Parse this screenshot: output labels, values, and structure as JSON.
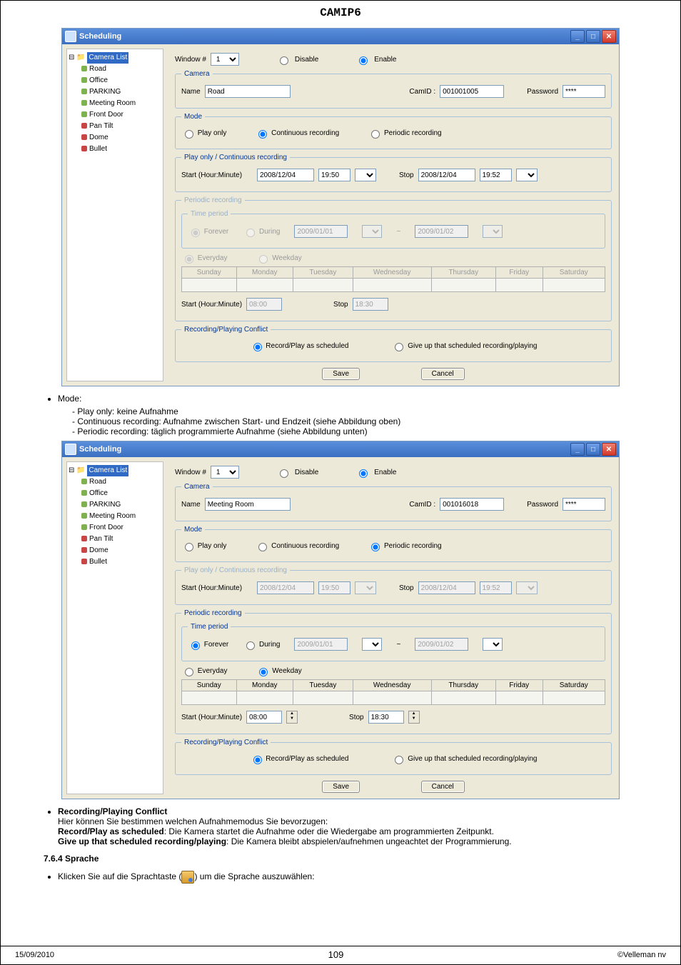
{
  "doc_title": "CAMIP6",
  "win1": {
    "title": "Scheduling",
    "tree": {
      "root": "Camera List",
      "items": [
        {
          "label": "Road",
          "color": "cg"
        },
        {
          "label": "Office",
          "color": "cg"
        },
        {
          "label": "PARKING",
          "color": "cg"
        },
        {
          "label": "Meeting Room",
          "color": "cg"
        },
        {
          "label": "Front Door",
          "color": "cg"
        },
        {
          "label": "Pan Tilt",
          "color": "cr"
        },
        {
          "label": "Dome",
          "color": "cr"
        },
        {
          "label": "Bullet",
          "color": "cr"
        }
      ]
    },
    "window_label": "Window #",
    "window_value": "1",
    "disable": "Disable",
    "enable": "Enable",
    "camera_legend": "Camera",
    "name_label": "Name",
    "name_value": "Road",
    "camid_label": "CamID :",
    "camid_value": "001001005",
    "password_label": "Password",
    "password_value": "****",
    "mode_legend": "Mode",
    "mode_play": "Play only",
    "mode_cont": "Continuous recording",
    "mode_per": "Periodic recording",
    "play_legend": "Play only / Continuous recording",
    "start_label": "Start (Hour:Minute)",
    "start_date": "2008/12/04",
    "start_time": "19:50",
    "stop_label": "Stop",
    "stop_date": "2008/12/04",
    "stop_time": "19:52",
    "periodic_legend": "Periodic recording",
    "timeperiod_legend": "Time period",
    "forever": "Forever",
    "during": "During",
    "during_from": "2009/01/01",
    "during_to": "2009/01/02",
    "everyday": "Everyday",
    "weekday": "Weekday",
    "days": [
      "Sunday",
      "Monday",
      "Tuesday",
      "Wednesday",
      "Thursday",
      "Friday",
      "Saturday"
    ],
    "start_hm_label": "Start (Hour:Minute)",
    "start_hm": "08:00",
    "stop_hm_label": "Stop",
    "stop_hm": "18:30",
    "conflict_legend": "Recording/Playing Conflict",
    "conflict_a": "Record/Play as scheduled",
    "conflict_b": "Give up that scheduled recording/playing",
    "save": "Save",
    "cancel": "Cancel"
  },
  "win2": {
    "name_value": "Meeting Room",
    "camid_value": "001016018"
  },
  "text": {
    "mode_h": "Mode:",
    "mode_li1": "Play only: keine Aufnahme",
    "mode_li2": "Continuous recording: Aufnahme zwischen Start- und Endzeit (siehe Abbildung oben)",
    "mode_li3": "Periodic recording: täglich programmierte Aufnahme (siehe Abbildung unten)",
    "conflict_h": "Recording/Playing Conflict",
    "conflict_p1": "Hier können Sie bestimmen welchen Aufnahmemodus Sie bevorzugen:",
    "conflict_b1a": "Record/Play as scheduled",
    "conflict_b1b": ": Die Kamera startet die Aufnahme oder die Wiedergabe am programmierten Zeitpunkt.",
    "conflict_b2a": "Give up that scheduled recording/playing",
    "conflict_b2b": ": Die Kamera bleibt abspielen/aufnehmen ungeachtet der Programmierung.",
    "sec764": "7.6.4 Sprache",
    "lang_li_a": "Klicken Sie auf die Sprachtaste (",
    "lang_li_b": ") um die Sprache auszuwählen:"
  },
  "footer": {
    "date": "15/09/2010",
    "page": "109",
    "copyright": "©Velleman nv"
  }
}
